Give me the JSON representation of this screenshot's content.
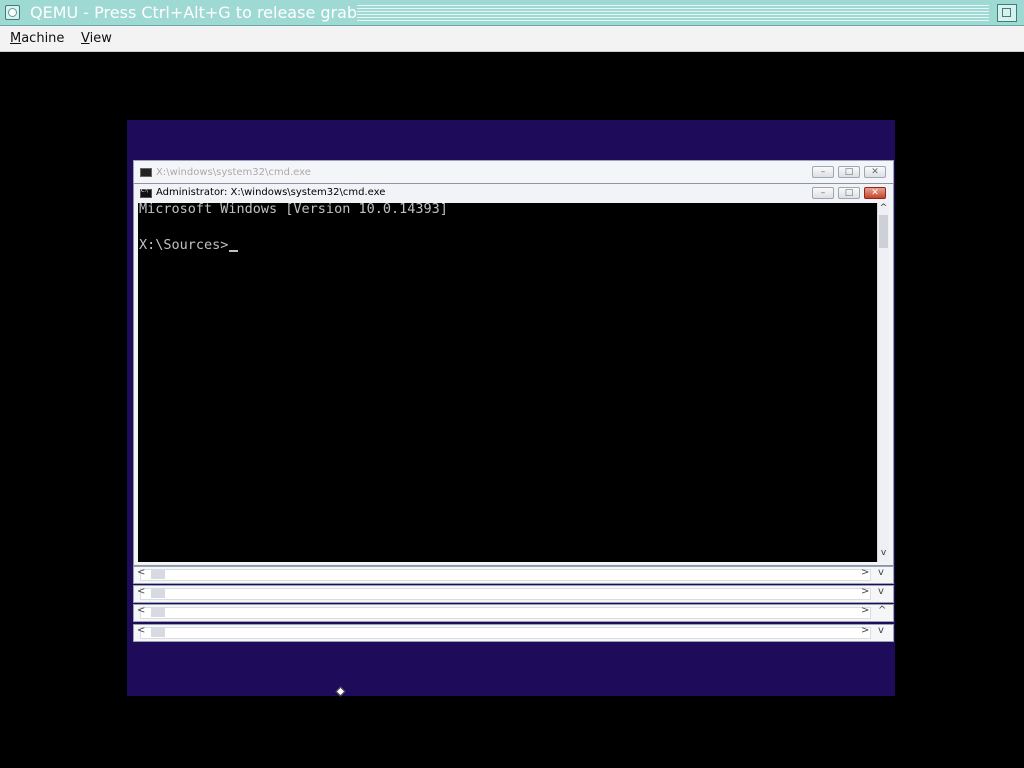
{
  "host": {
    "title": "QEMU - Press Ctrl+Alt+G to release grab",
    "menu": [
      {
        "mnemonic": "M",
        "rest": "achine"
      },
      {
        "mnemonic": "V",
        "rest": "iew"
      }
    ]
  },
  "background_window": {
    "title": "X:\\windows\\system32\\cmd.exe"
  },
  "cmd_window": {
    "title": "Administrator: X:\\windows\\system32\\cmd.exe",
    "buttons": {
      "minimize": "–",
      "maximize": "□",
      "close": "✕"
    },
    "console_lines": [
      "Microsoft Windows [Version 10.0.14393]",
      "",
      "X:\\Sources>"
    ]
  },
  "scrollbar_glyphs": {
    "left": "<",
    "right": ">",
    "down": "v",
    "up": "^"
  },
  "colors": {
    "host_titlebar": "#9fd9d3",
    "setup_background": "#1e0b5a",
    "console_bg": "#000000",
    "console_text": "#c0c0c0"
  }
}
